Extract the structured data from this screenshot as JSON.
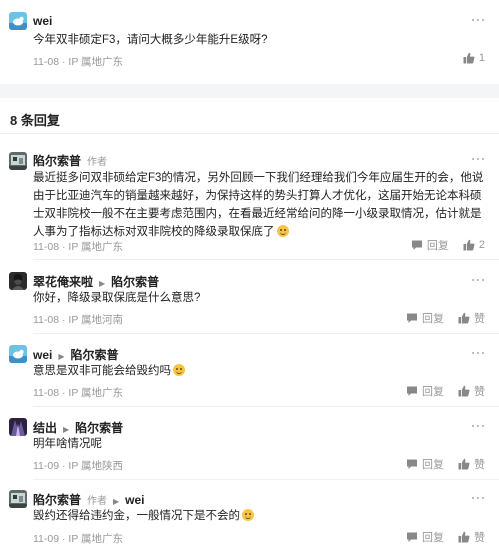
{
  "post": {
    "author": "wei",
    "text": "今年双非硕定F3，请问大概多少年能升E级呀?",
    "date": "11-08",
    "location": "· IP 属地广东",
    "likes": "1"
  },
  "replies_title": "8 条回复",
  "replies": [
    {
      "author": "陷尔索普",
      "role": "作者",
      "reply_to": "",
      "lines": [
        "最近挺多问双非硕给定F3的情况，另外回顾一下我们经理给我们今年应届生开的会，他说",
        "由于比亚迪汽车的销量越来越好，为保持这样的势头打算人才优化，这届开始无论本科硕",
        "士双非院校一般不在主要考虑范围内，在看最近经常给问的降一小级录取情况，估计就是",
        "人事为了指标达标对双非院校的降级录取保底了"
      ],
      "date": "11-08",
      "location": "· IP 属地广东",
      "reply_label": "回复",
      "like_label": "2"
    },
    {
      "author": "翠花俺来啦",
      "role": "",
      "reply_to": "陷尔索普",
      "lines": [
        "你好，降级录取保底是什么意思?"
      ],
      "date": "11-08",
      "location": "· IP 属地河南",
      "reply_label": "回复",
      "like_label": "赞"
    },
    {
      "author": "wei",
      "role": "",
      "reply_to": "陷尔索普",
      "lines": [
        "意思是双非可能会给毁约吗"
      ],
      "date": "11-08",
      "location": "· IP 属地广东",
      "reply_label": "回复",
      "like_label": "赞"
    },
    {
      "author": "结出",
      "role": "",
      "reply_to": "陷尔索普",
      "lines": [
        "明年啥情况呢"
      ],
      "date": "11-09",
      "location": "· IP 属地陕西",
      "reply_label": "回复",
      "like_label": "赞"
    },
    {
      "author": "陷尔索普",
      "role": "作者",
      "reply_to": "wei",
      "lines": [
        "毁约还得给违约金，一般情况下是不会的"
      ],
      "date": "11-09",
      "location": "· IP 属地广东",
      "reply_label": "回复",
      "like_label": "赞"
    }
  ],
  "icons": {
    "more": "more-dots-icon",
    "reply": "comment-bubble-icon",
    "like": "thumbs-up-icon"
  }
}
